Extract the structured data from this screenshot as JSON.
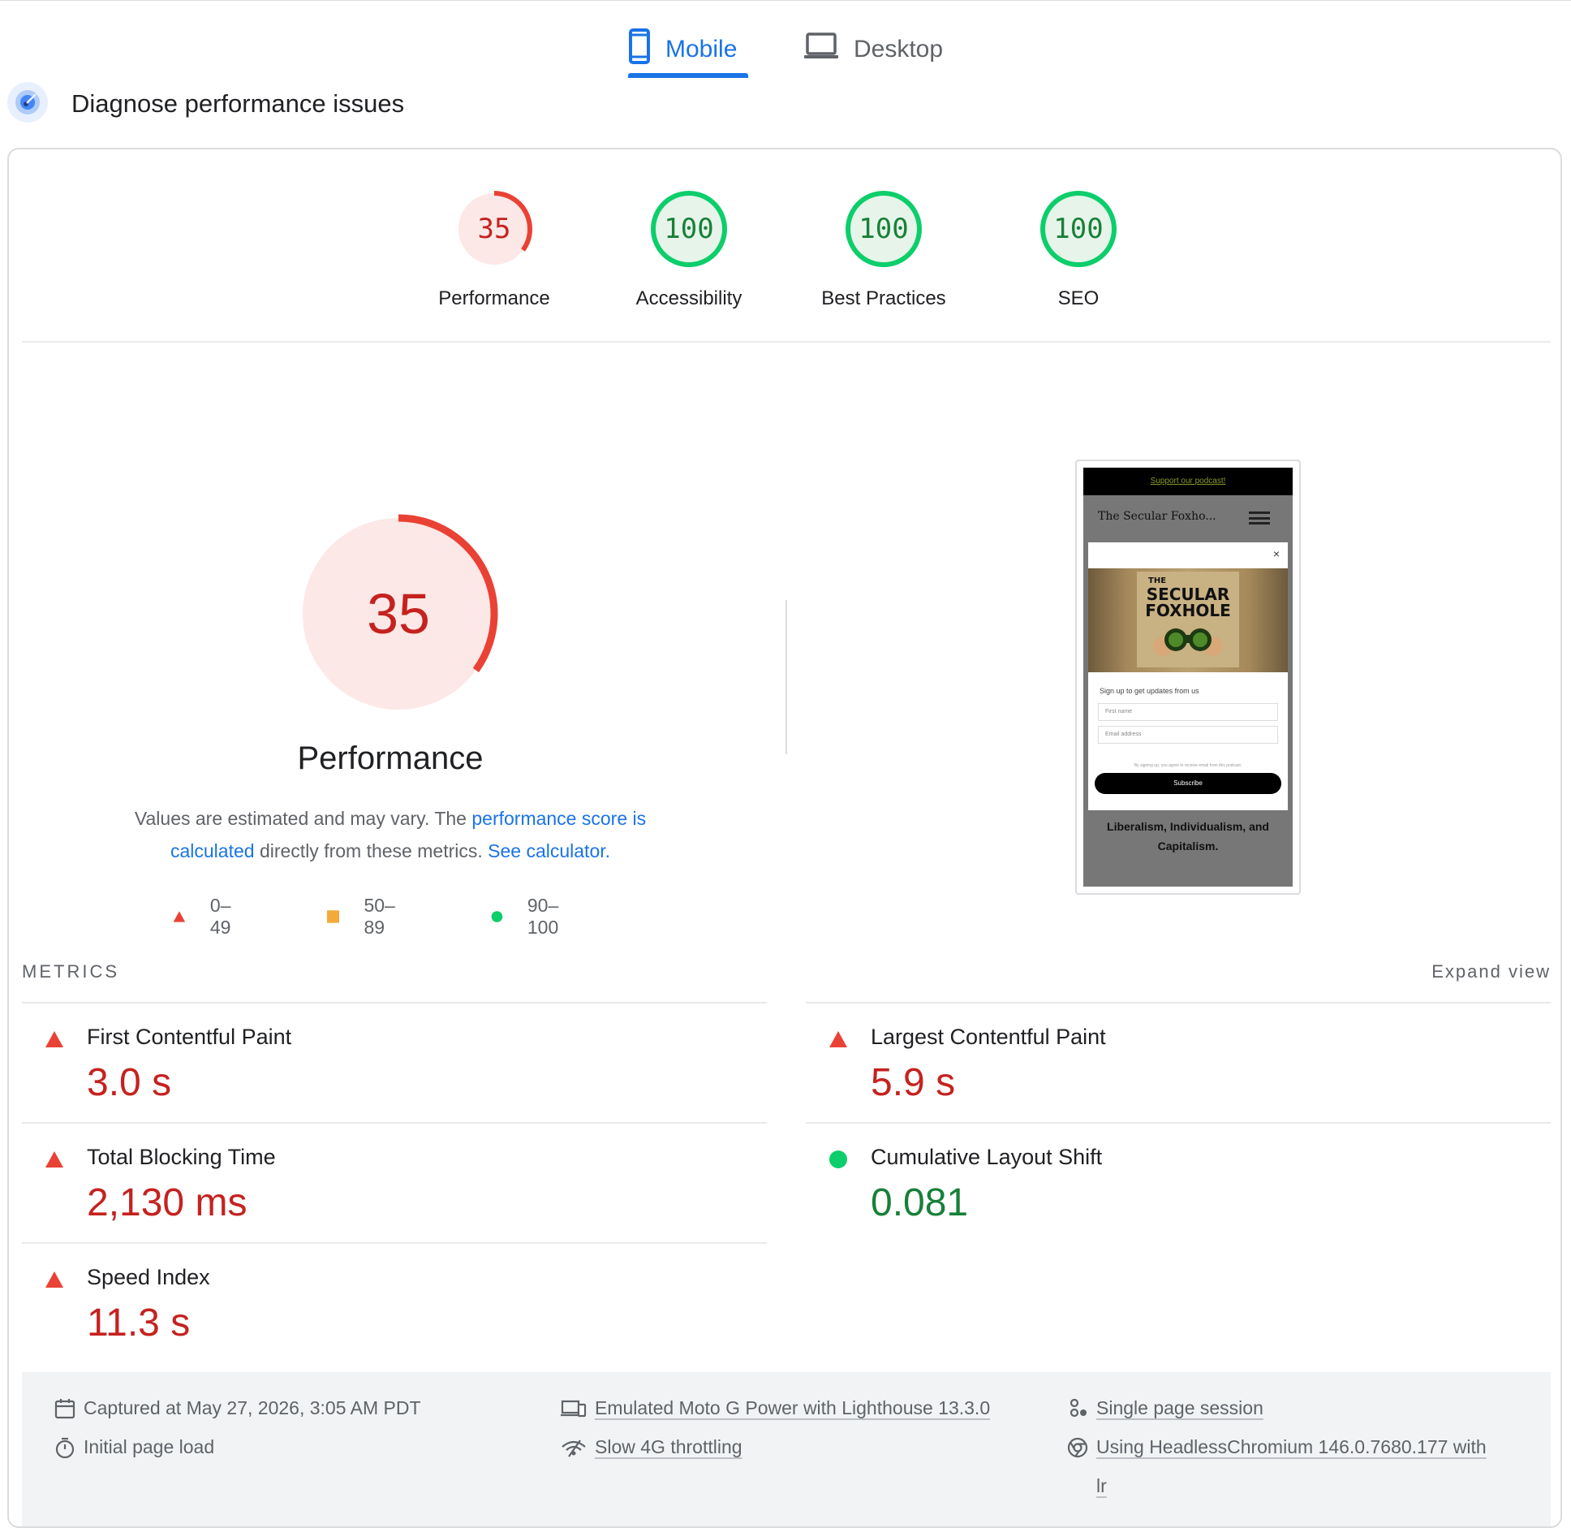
{
  "tabs": {
    "mobile": "Mobile",
    "desktop": "Desktop"
  },
  "heading": "Diagnose performance issues",
  "scores": [
    {
      "label": "Performance",
      "value": "35",
      "score": 35,
      "color": "#c5221f"
    },
    {
      "label": "Accessibility",
      "value": "100",
      "score": 100,
      "color": "#188038"
    },
    {
      "label": "Best Practices",
      "value": "100",
      "score": 100,
      "color": "#188038"
    },
    {
      "label": "SEO",
      "value": "100",
      "score": 100,
      "color": "#188038"
    }
  ],
  "performance": {
    "score": "35",
    "title": "Performance",
    "desc_1": "Values are estimated and may vary. The ",
    "desc_link_1": "performance score is calculated",
    "desc_2": " directly from these metrics. ",
    "desc_link_2": "See calculator."
  },
  "legend": {
    "fail": "0–49",
    "average": "50–89",
    "pass": "90–100"
  },
  "screenshot": {
    "banner": "Support our podcast!",
    "site_title": "The Secular Foxho...",
    "close": "×",
    "logo_line1": "THE",
    "logo_line2": "SECULAR",
    "logo_line3": "FOXHOLE",
    "signup": "Sign up to get updates from us",
    "first_name": "First name",
    "email": "Email address",
    "agree": "By signing up, you agree to receive email from this podcast.",
    "subscribe": "Subscribe",
    "footer_line1": "Liberalism, Individualism, and",
    "footer_line2": "Capitalism."
  },
  "metrics": {
    "title": "METRICS",
    "expand": "Expand view",
    "fcp": {
      "label": "First Contentful Paint",
      "value": "3.0 s"
    },
    "tbt": {
      "label": "Total Blocking Time",
      "value": "2,130 ms"
    },
    "si": {
      "label": "Speed Index",
      "value": "11.3 s"
    },
    "lcp": {
      "label": "Largest Contentful Paint",
      "value": "5.9 s"
    },
    "cls": {
      "label": "Cumulative Layout Shift",
      "value": "0.081"
    }
  },
  "footer": {
    "captured": "Captured at May 27, 2026, 3:05 AM PDT",
    "initial": "Initial page load",
    "emulated": "Emulated Moto G Power with Lighthouse 13.3.0",
    "throttling": "Slow 4G throttling",
    "session": "Single page session",
    "browser_1": "Using HeadlessChromium 146.0.7680.177 with",
    "browser_2": "lr"
  }
}
